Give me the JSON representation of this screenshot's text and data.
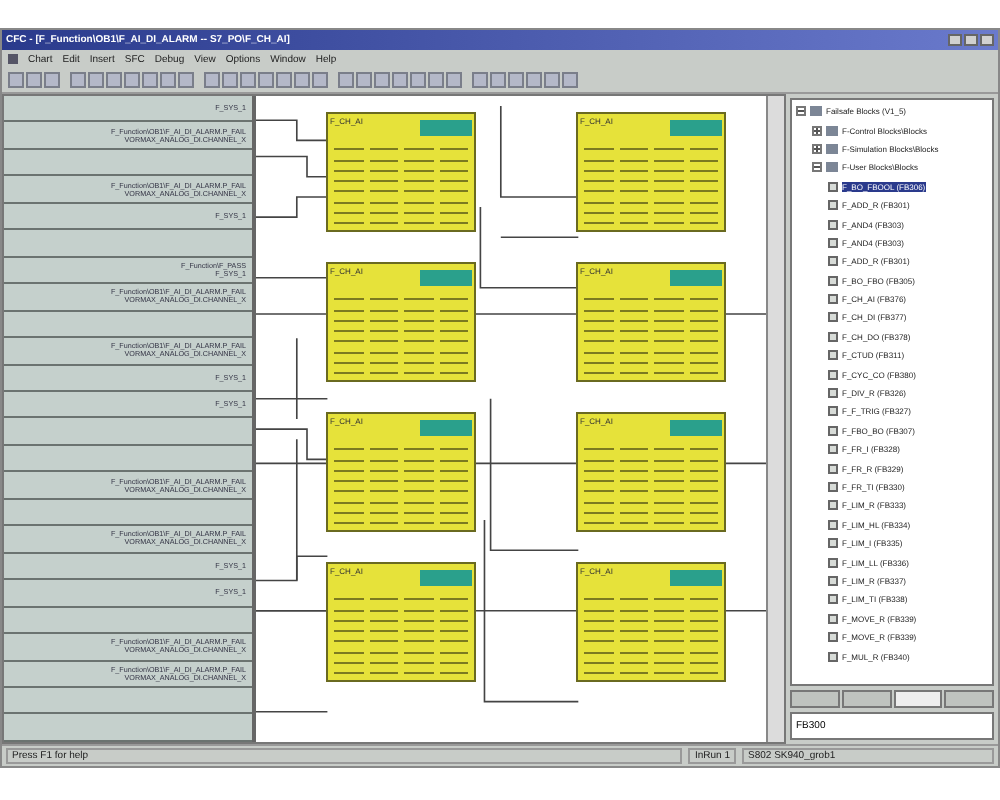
{
  "window": {
    "title": "CFC - [F_Function\\OB1\\F_AI_DI_ALARM -- S7_PO\\F_CH_AI]"
  },
  "menu": [
    "Chart",
    "Edit",
    "Insert",
    "SFC",
    "Debug",
    "View",
    "Options",
    "Window",
    "Help"
  ],
  "margin_rows": [
    {
      "text": "F_SYS_1"
    },
    {
      "text": "F_Function\\OB1\\F_AI_DI_ALARM.P_FAIL\nVORMAX_ANALOG_DI.CHANNEL_X"
    },
    {
      "text": ""
    },
    {
      "text": "F_Function\\OB1\\F_AI_DI_ALARM.P_FAIL\nVORMAX_ANALOG_DI.CHANNEL_X"
    },
    {
      "text": "F_SYS_1"
    },
    {
      "text": ""
    },
    {
      "text": "F_Function\\F_PASS\nF_SYS_1"
    },
    {
      "text": "F_Function\\OB1\\F_AI_DI_ALARM.P_FAIL\nVORMAX_ANALOG_DI.CHANNEL_X"
    },
    {
      "text": ""
    },
    {
      "text": "F_Function\\OB1\\F_AI_DI_ALARM.P_FAIL\nVORMAX_ANALOG_DI.CHANNEL_X"
    },
    {
      "text": "F_SYS_1"
    },
    {
      "text": "F_SYS_1"
    },
    {
      "text": ""
    },
    {
      "text": ""
    },
    {
      "text": "F_Function\\OB1\\F_AI_DI_ALARM.P_FAIL\nVORMAX_ANALOG_DI.CHANNEL_X"
    },
    {
      "text": ""
    },
    {
      "text": "F_Function\\OB1\\F_AI_DI_ALARM.P_FAIL\nVORMAX_ANALOG_DI.CHANNEL_X"
    },
    {
      "text": "F_SYS_1"
    },
    {
      "text": "F_SYS_1"
    },
    {
      "text": ""
    },
    {
      "text": "F_Function\\OB1\\F_AI_DI_ALARM.P_FAIL\nVORMAX_ANALOG_DI.CHANNEL_X"
    },
    {
      "text": "F_Function\\OB1\\F_AI_DI_ALARM.P_FAIL\nVORMAX_ANALOG_DI.CHANNEL_X"
    },
    {
      "text": ""
    },
    {
      "text": ""
    }
  ],
  "blocks": [
    {
      "label": "F_CH_AI"
    },
    {
      "label": "F_CH_AI"
    },
    {
      "label": "F_CH_AI"
    },
    {
      "label": "F_CH_AI"
    },
    {
      "label": "F_CH_AI"
    },
    {
      "label": "F_CH_AI"
    },
    {
      "label": "F_CH_AI"
    },
    {
      "label": "F_CH_AI"
    }
  ],
  "tree": [
    {
      "label": "Failsafe Blocks (V1_5)",
      "expanded": true,
      "children": [
        {
          "label": "F-Control Blocks\\Blocks",
          "expanded": false
        },
        {
          "label": "F-Simulation Blocks\\Blocks",
          "expanded": false
        },
        {
          "label": "F-User Blocks\\Blocks",
          "expanded": true,
          "children": [
            {
              "label": "F_BO_FBOOL (FB306)",
              "selected": true
            },
            {
              "label": "F_ADD_R (FB301)",
              "selected": false
            },
            {
              "label": "F_AND4 (FB303)",
              "selected": false
            },
            {
              "label": "F_AND4 (FB303)",
              "selected": false
            },
            {
              "label": "F_ADD_R (FB301)",
              "selected": false
            },
            {
              "label": "F_BO_FBO (FB305)",
              "selected": false
            },
            {
              "label": "F_CH_AI (FB376)",
              "selected": false
            },
            {
              "label": "F_CH_DI (FB377)",
              "selected": false
            },
            {
              "label": "F_CH_DO (FB378)",
              "selected": false
            },
            {
              "label": "F_CTUD (FB311)",
              "selected": false
            },
            {
              "label": "F_CYC_CO (FB380)",
              "selected": false
            },
            {
              "label": "F_DIV_R (FB326)",
              "selected": false
            },
            {
              "label": "F_F_TRIG (FB327)",
              "selected": false
            },
            {
              "label": "F_FBO_BO (FB307)",
              "selected": false
            },
            {
              "label": "F_FR_I (FB328)",
              "selected": false
            },
            {
              "label": "F_FR_R (FB329)",
              "selected": false
            },
            {
              "label": "F_FR_TI (FB330)",
              "selected": false
            },
            {
              "label": "F_LIM_R (FB333)",
              "selected": false
            },
            {
              "label": "F_LIM_HL (FB334)",
              "selected": false
            },
            {
              "label": "F_LIM_I (FB335)",
              "selected": false
            },
            {
              "label": "F_LIM_LL (FB336)",
              "selected": false
            },
            {
              "label": "F_LIM_R (FB337)",
              "selected": false
            },
            {
              "label": "F_LIM_TI (FB338)",
              "selected": false
            },
            {
              "label": "F_MOVE_R (FB339)",
              "selected": false
            },
            {
              "label": "F_MOVE_R (FB339)",
              "selected": false
            },
            {
              "label": "F_MUL_R (FB340)",
              "selected": false
            }
          ]
        }
      ]
    }
  ],
  "panel_tabs": [
    {
      "selected": false
    },
    {
      "selected": false
    },
    {
      "selected": true
    },
    {
      "selected": false
    }
  ],
  "search": {
    "value": "FB300"
  },
  "status_bar": {
    "help": "Press F1 for help",
    "mode": "InRun 1",
    "path": "S802 SK940_grob1"
  }
}
